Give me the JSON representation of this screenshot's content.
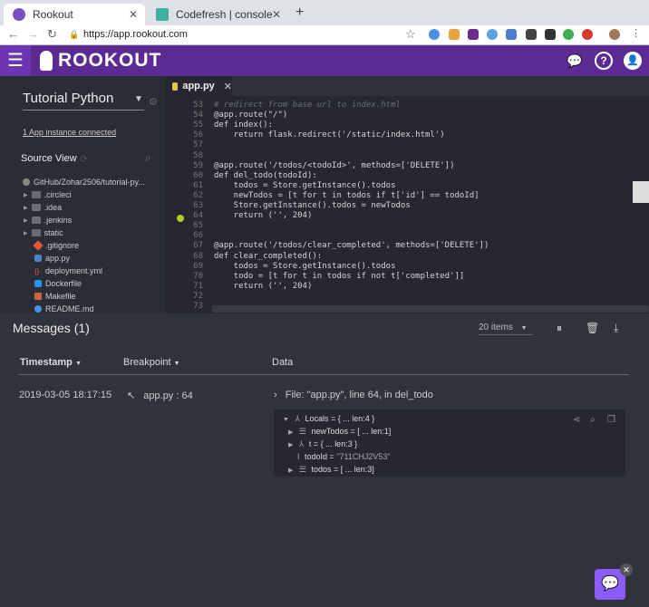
{
  "browser": {
    "tabs": [
      {
        "title": "Rookout",
        "close": "✕"
      },
      {
        "title": "Codefresh | console",
        "close": "✕"
      }
    ],
    "new_tab": "+",
    "url": "https://app.rookout.com",
    "nav": {
      "back": "←",
      "forward": "→",
      "reload": "↻",
      "lock": "🔒",
      "star": "☆"
    }
  },
  "header": {
    "menu": "☰",
    "logo": "ROOKOUT",
    "icons": {
      "chat": "💬",
      "help": "?",
      "account": "👤"
    }
  },
  "sidebar": {
    "project": "Tutorial Python",
    "instances_link": "1 App instance connected",
    "source_view_title": "Source View",
    "tree": [
      {
        "label": "GitHub/Zohar2506/tutorial-py...",
        "kind": "repo"
      },
      {
        "label": ".circleci",
        "kind": "folder"
      },
      {
        "label": ".idea",
        "kind": "folder"
      },
      {
        "label": ".jenkins",
        "kind": "folder"
      },
      {
        "label": "static",
        "kind": "folder"
      },
      {
        "label": ".gitignore",
        "kind": "git"
      },
      {
        "label": "app.py",
        "kind": "py"
      },
      {
        "label": "deployment.yml",
        "kind": "yml"
      },
      {
        "label": "Dockerfile",
        "kind": "docker"
      },
      {
        "label": "Makefile",
        "kind": "make"
      },
      {
        "label": "README.md",
        "kind": "md"
      }
    ]
  },
  "editor": {
    "tab": "app.py",
    "tab_close": "✕",
    "lines": [
      {
        "n": "53",
        "t": "# redirect from base url to index.html",
        "c": true
      },
      {
        "n": "54",
        "t": "@app.route(\"/\")"
      },
      {
        "n": "55",
        "t": "def index():"
      },
      {
        "n": "56",
        "t": "    return flask.redirect('/static/index.html')"
      },
      {
        "n": "57",
        "t": ""
      },
      {
        "n": "58",
        "t": ""
      },
      {
        "n": "59",
        "t": "@app.route('/todos/<todoId>', methods=['DELETE'])"
      },
      {
        "n": "60",
        "t": "def del_todo(todoId):"
      },
      {
        "n": "61",
        "t": "    todos = Store.getInstance().todos"
      },
      {
        "n": "62",
        "t": "    newTodos = [t for t in todos if t['id'] == todoId]"
      },
      {
        "n": "63",
        "t": "    Store.getInstance().todos = newTodos"
      },
      {
        "n": "64",
        "t": "    return ('', 204)"
      },
      {
        "n": "65",
        "t": ""
      },
      {
        "n": "66",
        "t": ""
      },
      {
        "n": "67",
        "t": "@app.route('/todos/clear_completed', methods=['DELETE'])"
      },
      {
        "n": "68",
        "t": "def clear_completed():"
      },
      {
        "n": "69",
        "t": "    todos = Store.getInstance().todos"
      },
      {
        "n": "70",
        "t": "    todo = [t for t in todos if not t['completed']]"
      },
      {
        "n": "71",
        "t": "    return ('', 204)"
      },
      {
        "n": "72",
        "t": ""
      },
      {
        "n": "73",
        "t": ""
      }
    ]
  },
  "messages": {
    "title": "Messages (1)",
    "items_select": "20 items",
    "columns": {
      "timestamp": "Timestamp",
      "breakpoint": "Breakpoint",
      "data": "Data"
    },
    "row": {
      "timestamp": "2019-03-05 18:17:15",
      "breakpoint": "app.py : 64",
      "data": "File: \"app.py\", line 64, in del_todo"
    },
    "tree": [
      {
        "text": "Locals = { ... len:4 }"
      },
      {
        "text": "newTodos = [ ... len:1]"
      },
      {
        "text": "t = { ... len:3 }"
      },
      {
        "key": "todoId = ",
        "val": "\"711CHJ2V53\""
      },
      {
        "text": "todos = [ ... len:3]"
      }
    ]
  },
  "chat": {
    "icon": "💬",
    "close": "✕"
  }
}
